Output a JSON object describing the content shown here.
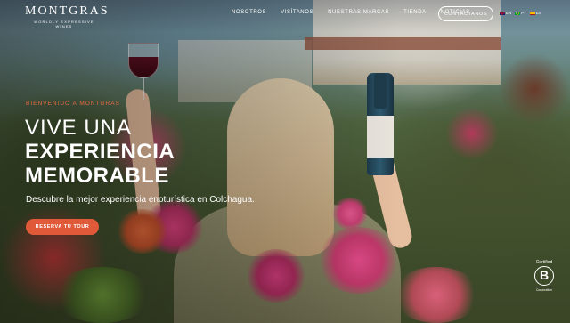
{
  "brand": {
    "name": "MONTGRAS",
    "tagline": "WORLDLY EXPRESSIVE WINES"
  },
  "nav": {
    "items": [
      {
        "label": "NOSOTROS"
      },
      {
        "label": "VISÍTANOS"
      },
      {
        "label": "NUESTRAS MARCAS"
      },
      {
        "label": "TIENDA"
      },
      {
        "label": "NOTICIAS"
      }
    ],
    "contact_label": "CONTÁCTANOS"
  },
  "languages": [
    {
      "code": "EN",
      "icon": "flag-uk-icon"
    },
    {
      "code": "PT",
      "icon": "flag-brazil-icon"
    },
    {
      "code": "ES",
      "icon": "flag-spain-icon"
    }
  ],
  "hero": {
    "eyebrow": "BIENVENIDO A MONTGRAS",
    "heading_light": "VIVE UNA",
    "heading_bold_1": "EXPERIENCIA",
    "heading_bold_2": "MEMORABLE",
    "subtitle": "Descubre la mejor experiencia enoturística en Colchagua.",
    "cta_label": "RESERVA TU TOUR"
  },
  "certification": {
    "top": "Certified",
    "letter": "B",
    "bottom": "Corporation"
  },
  "colors": {
    "accent": "#e05a3a",
    "eyebrow": "#e46a3f",
    "text": "#ffffff"
  }
}
